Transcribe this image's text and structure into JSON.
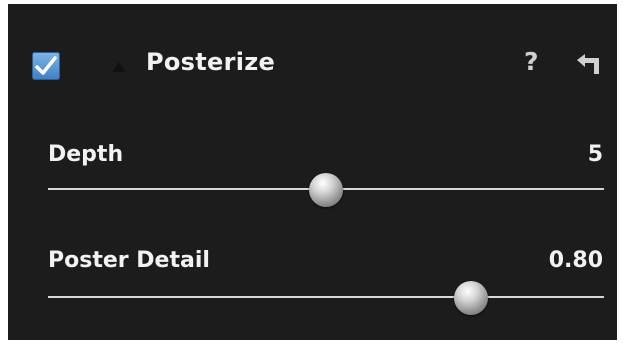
{
  "panel": {
    "enabled": true,
    "title": "Posterize",
    "help_label": "?"
  },
  "sliders": [
    {
      "label": "Depth",
      "value": "5",
      "level": 0.5
    },
    {
      "label": "Poster Detail",
      "value": "0.80",
      "level": 0.76
    }
  ],
  "colors": {
    "panel_background": "#1c1c1c",
    "text": "#f2f2f2",
    "checkbox_accent": "#4a90d9",
    "track": "#d8d8d8"
  },
  "icons": {
    "checkbox": "checkmark-icon",
    "disclosure": "disclosure-triangle-icon",
    "help": "question-mark-icon",
    "reset": "reset-arrow-icon"
  }
}
